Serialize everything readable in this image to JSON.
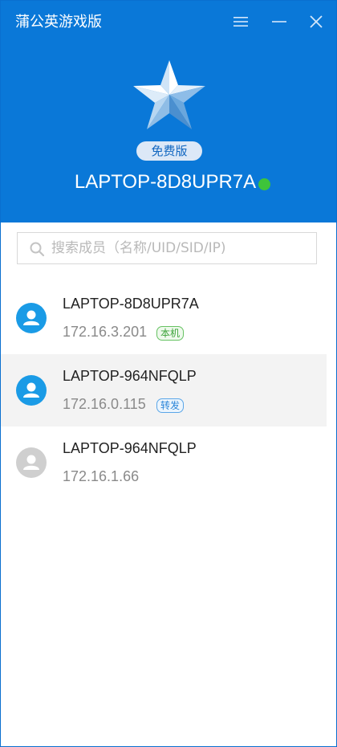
{
  "app": {
    "title": "蒲公英游戏版"
  },
  "header": {
    "edition": "免费版",
    "host_name": "LAPTOP-8D8UPR7A",
    "status_color": "#3ec43a",
    "accent_color": "#0a78d8"
  },
  "search": {
    "placeholder": "搜索成员（名称/UID/SID/IP)",
    "value": ""
  },
  "members": [
    {
      "name": "LAPTOP-8D8UPR7A",
      "ip": "172.16.3.201",
      "tag": "本机",
      "online": true
    },
    {
      "name": "LAPTOP-964NFQLP",
      "ip": "172.16.0.115",
      "tag": "转发",
      "online": true
    },
    {
      "name": "LAPTOP-964NFQLP",
      "ip": "172.16.1.66",
      "tag": "",
      "online": false
    }
  ]
}
